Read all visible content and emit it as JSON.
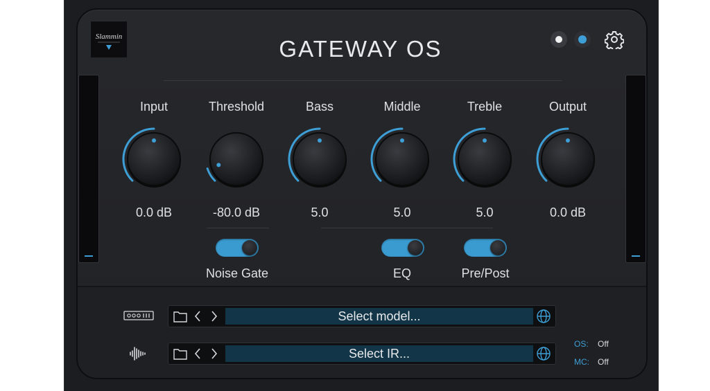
{
  "title": "GATEWAY OS",
  "logo_text": "Slammin",
  "header": {
    "mode_dots": [
      "white-dot",
      "blue-dot"
    ],
    "settings_icon": "gear-icon"
  },
  "knobs": [
    {
      "label": "Input",
      "value": "0.0 dB",
      "level": 0.5
    },
    {
      "label": "Threshold",
      "value": "-80.0 dB",
      "level": 0.1
    },
    {
      "label": "Bass",
      "value": "5.0",
      "level": 0.5
    },
    {
      "label": "Middle",
      "value": "5.0",
      "level": 0.5
    },
    {
      "label": "Treble",
      "value": "5.0",
      "level": 0.5
    },
    {
      "label": "Output",
      "value": "0.0 dB",
      "level": 0.5
    }
  ],
  "toggles": [
    {
      "label": "Noise Gate",
      "on": true
    },
    {
      "label": "EQ",
      "on": true
    },
    {
      "label": "Pre/Post",
      "on": true
    }
  ],
  "loaders": {
    "model": {
      "placeholder": "Select model...",
      "icon": "amp-model-icon"
    },
    "ir": {
      "placeholder": "Select IR...",
      "icon": "waveform-icon"
    }
  },
  "status": {
    "os_label": "OS:",
    "os_value": "Off",
    "mc_label": "MC:",
    "mc_value": "Off"
  },
  "colors": {
    "accent": "#3d9fd6",
    "panel": "#25262a",
    "field": "#123548",
    "text": "#dfe0e3"
  }
}
